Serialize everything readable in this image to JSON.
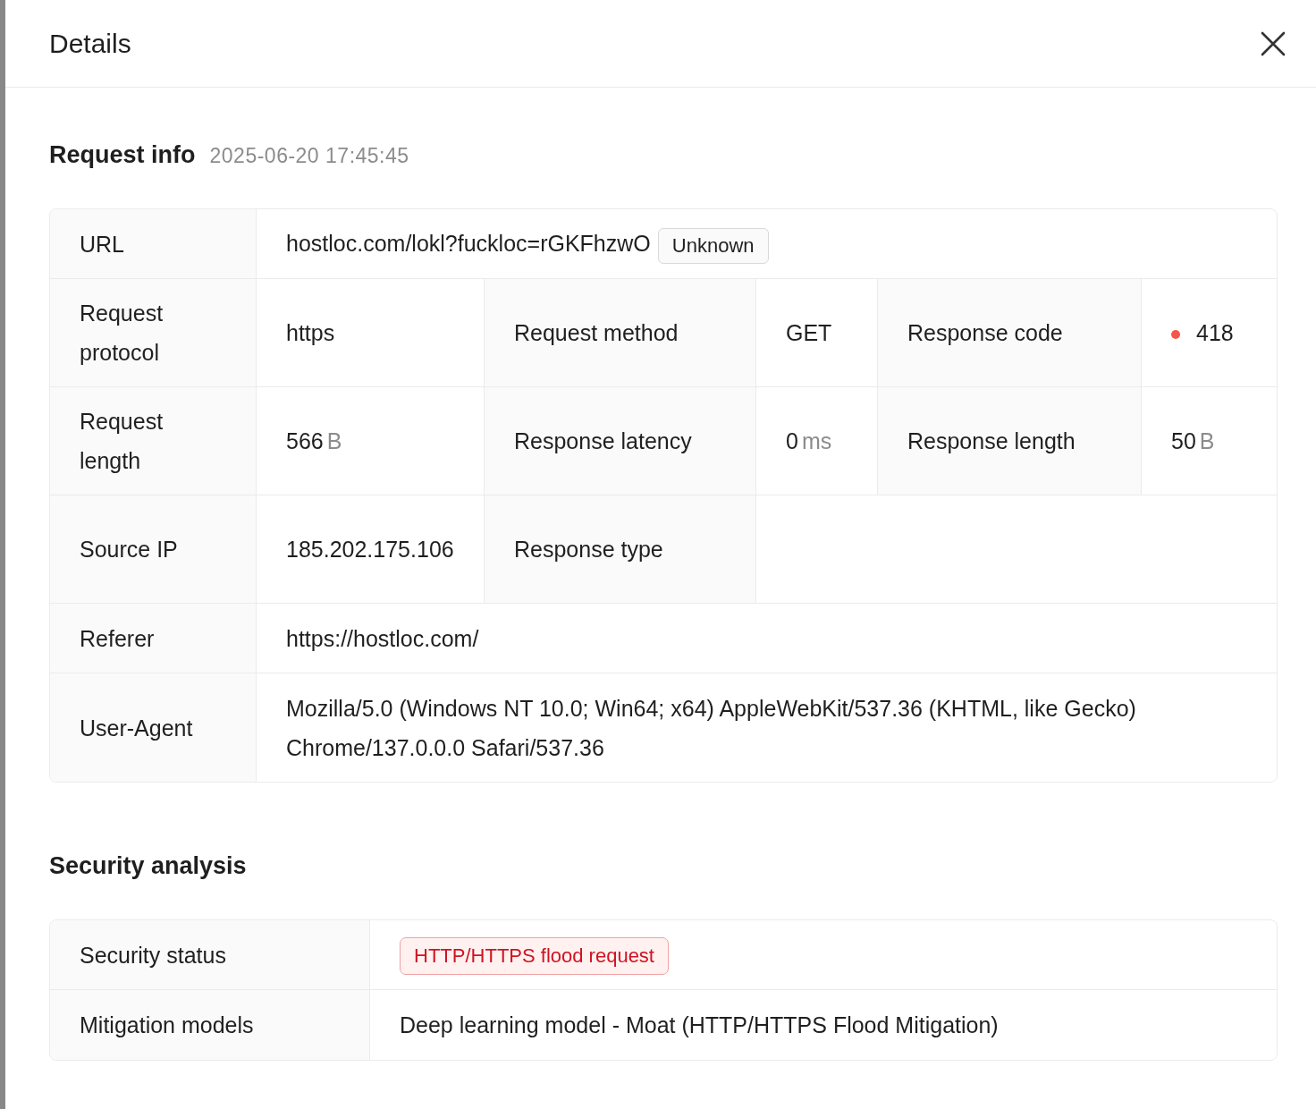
{
  "drawer": {
    "title": "Details"
  },
  "request_info": {
    "title": "Request info",
    "timestamp": "2025-06-20 17:45:45",
    "rows": [
      [
        {
          "label": "URL",
          "value": "hostloc.com/lokl?fuckloc=rGKFhzwO",
          "tag": "Unknown"
        }
      ],
      [
        {
          "label": "Request protocol",
          "value": "https"
        },
        {
          "label": "Request method",
          "value": "GET"
        },
        {
          "label": "Response code",
          "value": "418",
          "color": "#f5564a"
        }
      ],
      [
        {
          "label": "Request length",
          "value": "566",
          "unit": "B"
        },
        {
          "label": "Response latency",
          "value": "0",
          "unit": "ms"
        },
        {
          "label": "Response length",
          "value": "50",
          "unit": "B"
        }
      ],
      [
        {
          "label": "Source IP",
          "value": "185.202.175.106"
        },
        {
          "label": "Response type"
        }
      ],
      [
        {
          "label": "Referer",
          "value": "https://hostloc.com/"
        }
      ],
      [
        {
          "label": "User-Agent",
          "value": "Mozilla/5.0 (Windows NT 10.0; Win64; x64) AppleWebKit/537.36 (KHTML, like Gecko) Chrome/137.0.0.0 Safari/537.36"
        }
      ]
    ]
  },
  "security_analysis": {
    "title": "Security analysis",
    "rows": [
      {
        "label": "Security status",
        "kind": "tag",
        "value": "HTTP/HTTPS flood request"
      },
      {
        "label": "Mitigation models",
        "kind": "text",
        "value": "Deep learning model - Moat (HTTP/HTTPS Flood Mitigation)"
      }
    ]
  }
}
